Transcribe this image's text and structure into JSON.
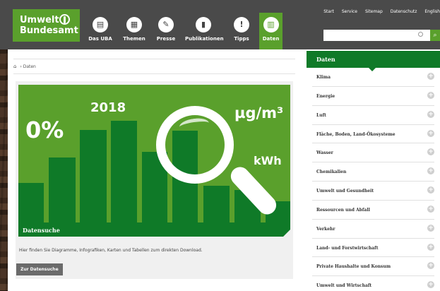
{
  "header": {
    "logo_line1": "Umwelt",
    "logo_line2": "Bundesamt",
    "nav": [
      {
        "label": "Das UBA",
        "icon": "building-icon",
        "glyph": "▤"
      },
      {
        "label": "Themen",
        "icon": "grid-icon",
        "glyph": "▦"
      },
      {
        "label": "Presse",
        "icon": "newspaper-icon",
        "glyph": "✎"
      },
      {
        "label": "Publikationen",
        "icon": "book-icon",
        "glyph": "▮"
      },
      {
        "label": "Tipps",
        "icon": "lightbulb-icon",
        "glyph": "!"
      },
      {
        "label": "Daten",
        "icon": "bar-chart-icon",
        "glyph": "▥",
        "active": true
      }
    ],
    "top_links": [
      "Start",
      "Service",
      "Sitemap",
      "Datenschutz",
      "English"
    ],
    "search_placeholder": "",
    "search_button_glyph": "⌕"
  },
  "breadcrumb": {
    "home_glyph": "⌂",
    "separator": "›",
    "current": "Daten"
  },
  "teaser": {
    "percent": "0%",
    "year": "2018",
    "unit_top": "µg/m³",
    "unit_mid": "kWh",
    "caption": "Datensuche",
    "description": "Hier finden Sie Diagramme, Infografiken, Karten und Tabellen zum direkten Download.",
    "button": "Zur Datensuche"
  },
  "sidebar": {
    "title": "Daten",
    "items": [
      "Klima",
      "Energie",
      "Luft",
      "Fläche, Boden, Land-Ökosysteme",
      "Wasser",
      "Chemikalien",
      "Umwelt und Gesundheit",
      "Ressourcen und Abfall",
      "Verkehr",
      "Land- und Forstwirtschaft",
      "Private Haushalte und Konsum",
      "Umwelt und Wirtschaft"
    ],
    "expand_glyph": "+"
  },
  "colors": {
    "brand_green": "#5aa02c",
    "dark_green": "#0f7a28",
    "header_gray": "#4a4a4a"
  }
}
